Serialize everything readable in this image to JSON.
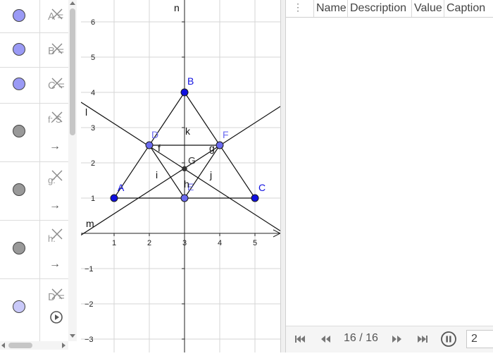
{
  "algebra": {
    "rows": [
      {
        "name": "A =",
        "color": "#9a9af5"
      },
      {
        "name": "B =",
        "color": "#9a9af5"
      },
      {
        "name": "C =",
        "color": "#9a9af5"
      },
      {
        "name": "f: S",
        "arrow": "→",
        "color": "#9a9a9a"
      },
      {
        "name": "g:",
        "arrow": "→",
        "color": "#9a9a9a"
      },
      {
        "name": "h:",
        "arrow": "→",
        "color": "#9a9a9a"
      },
      {
        "name": "D =",
        "color": "#c9c9f9"
      }
    ]
  },
  "graphics": {
    "x_ticks": [
      "1",
      "2",
      "3",
      "4",
      "5"
    ],
    "y_ticks": [
      "6",
      "5",
      "4",
      "3",
      "2",
      "1",
      "−1",
      "−2",
      "−3"
    ],
    "points": [
      {
        "label": "A",
        "x": 1,
        "y": 1,
        "color": "#1010e0"
      },
      {
        "label": "B",
        "x": 3,
        "y": 4,
        "color": "#1010e0"
      },
      {
        "label": "C",
        "x": 5,
        "y": 1,
        "color": "#1010e0"
      },
      {
        "label": "D",
        "x": 2,
        "y": 2.5,
        "color": "#6a6af0"
      },
      {
        "label": "E",
        "x": 3,
        "y": 1,
        "color": "#6a6af0"
      },
      {
        "label": "F",
        "x": 4,
        "y": 2.5,
        "color": "#6a6af0"
      },
      {
        "label": "G",
        "x": 3,
        "y": 1.833,
        "color": "#333333"
      }
    ],
    "line_labels": [
      "n",
      "l",
      "k",
      "f",
      "g",
      "i",
      "j",
      "h",
      "m"
    ]
  },
  "table": {
    "headers": [
      "Name",
      "Description",
      "Value",
      "Caption"
    ]
  },
  "playback": {
    "counter": "16 / 16",
    "step_value": "2"
  }
}
